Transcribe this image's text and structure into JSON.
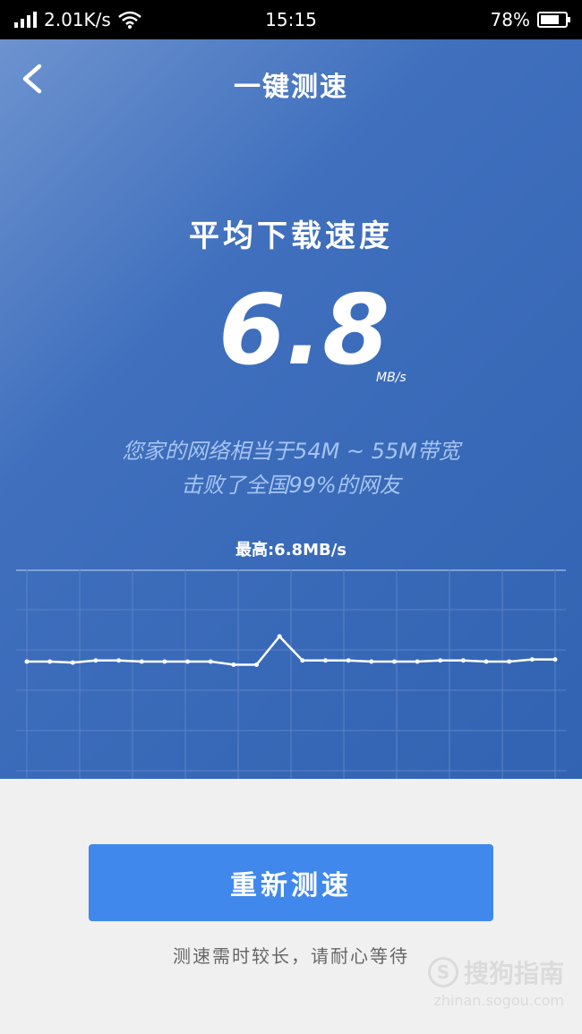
{
  "status_bar": {
    "network_speed": "2.01K/s",
    "time": "15:15",
    "battery": "78%",
    "battery_level": 0.78
  },
  "header": {
    "title": "一键测速"
  },
  "result": {
    "label": "平均下载速度",
    "value": "6.8",
    "unit": "MB/s",
    "bandwidth_text": "您家的网络相当于54M ~ 55M带宽",
    "rank_text": "击败了全国99%的网友",
    "max_label": "最高:6.8MB/s"
  },
  "chart_data": {
    "type": "line",
    "values": [
      5.6,
      5.6,
      5.55,
      5.65,
      5.65,
      5.6,
      5.6,
      5.6,
      5.6,
      5.45,
      5.45,
      6.8,
      5.65,
      5.65,
      5.65,
      5.6,
      5.6,
      5.6,
      5.65,
      5.65,
      5.6,
      5.6,
      5.7,
      5.7
    ],
    "ylim": [
      0,
      10
    ],
    "grid": true,
    "line_color": "#ffffff",
    "grid_color": "#5a82c6"
  },
  "actions": {
    "retest_label": "重新测速",
    "hint": "测速需时较长，请耐心等待"
  },
  "watermark": {
    "logo_mark": "S",
    "brand": "搜狗指南",
    "url": "zhinan.sogou.com"
  },
  "colors": {
    "accent": "#4188ec",
    "hero_start": "#6d93cf",
    "hero_end": "#3163b2"
  }
}
